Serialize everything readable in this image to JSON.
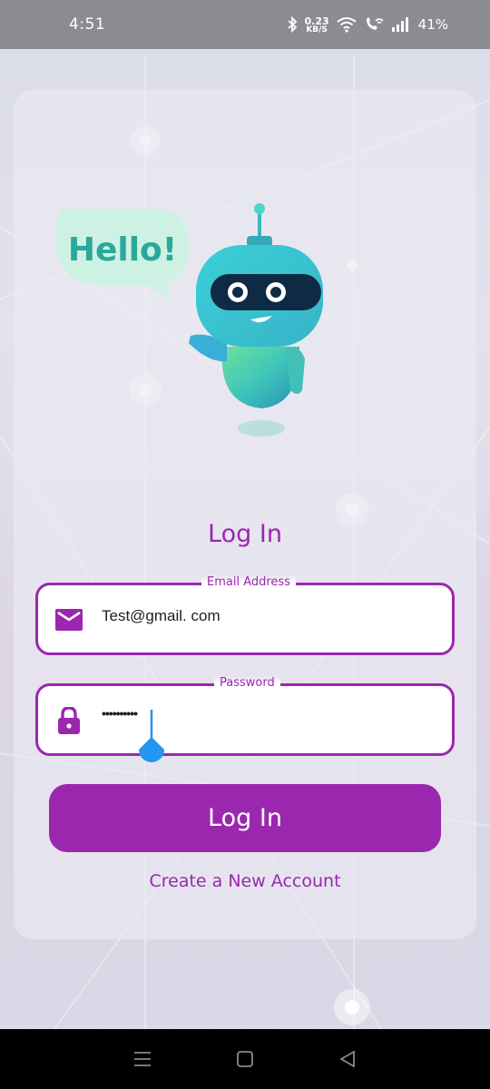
{
  "status_bar": {
    "time": "4:51",
    "net_speed_value": "0.23",
    "net_speed_unit": "KB/S",
    "battery": "41%",
    "icons": [
      "bluetooth-icon",
      "wifi-icon",
      "wifi-call-icon",
      "signal-icon"
    ]
  },
  "illustration": {
    "speech_bubble_text": "Hello!"
  },
  "form": {
    "title": "Log In",
    "email": {
      "label": "Email Address",
      "value": "Test@gmail. com",
      "icon": "mail-icon"
    },
    "password": {
      "label": "Password",
      "value": "••••••••••",
      "icon": "lock-icon"
    },
    "submit_label": "Log In",
    "create_account_label": "Create a New Account"
  },
  "nav_bar": {
    "buttons": [
      "menu-icon",
      "home-icon",
      "back-icon"
    ]
  },
  "colors": {
    "accent": "#9b27af",
    "robot_teal": "#3ec6c3",
    "cursor_handle": "#2196f3"
  }
}
